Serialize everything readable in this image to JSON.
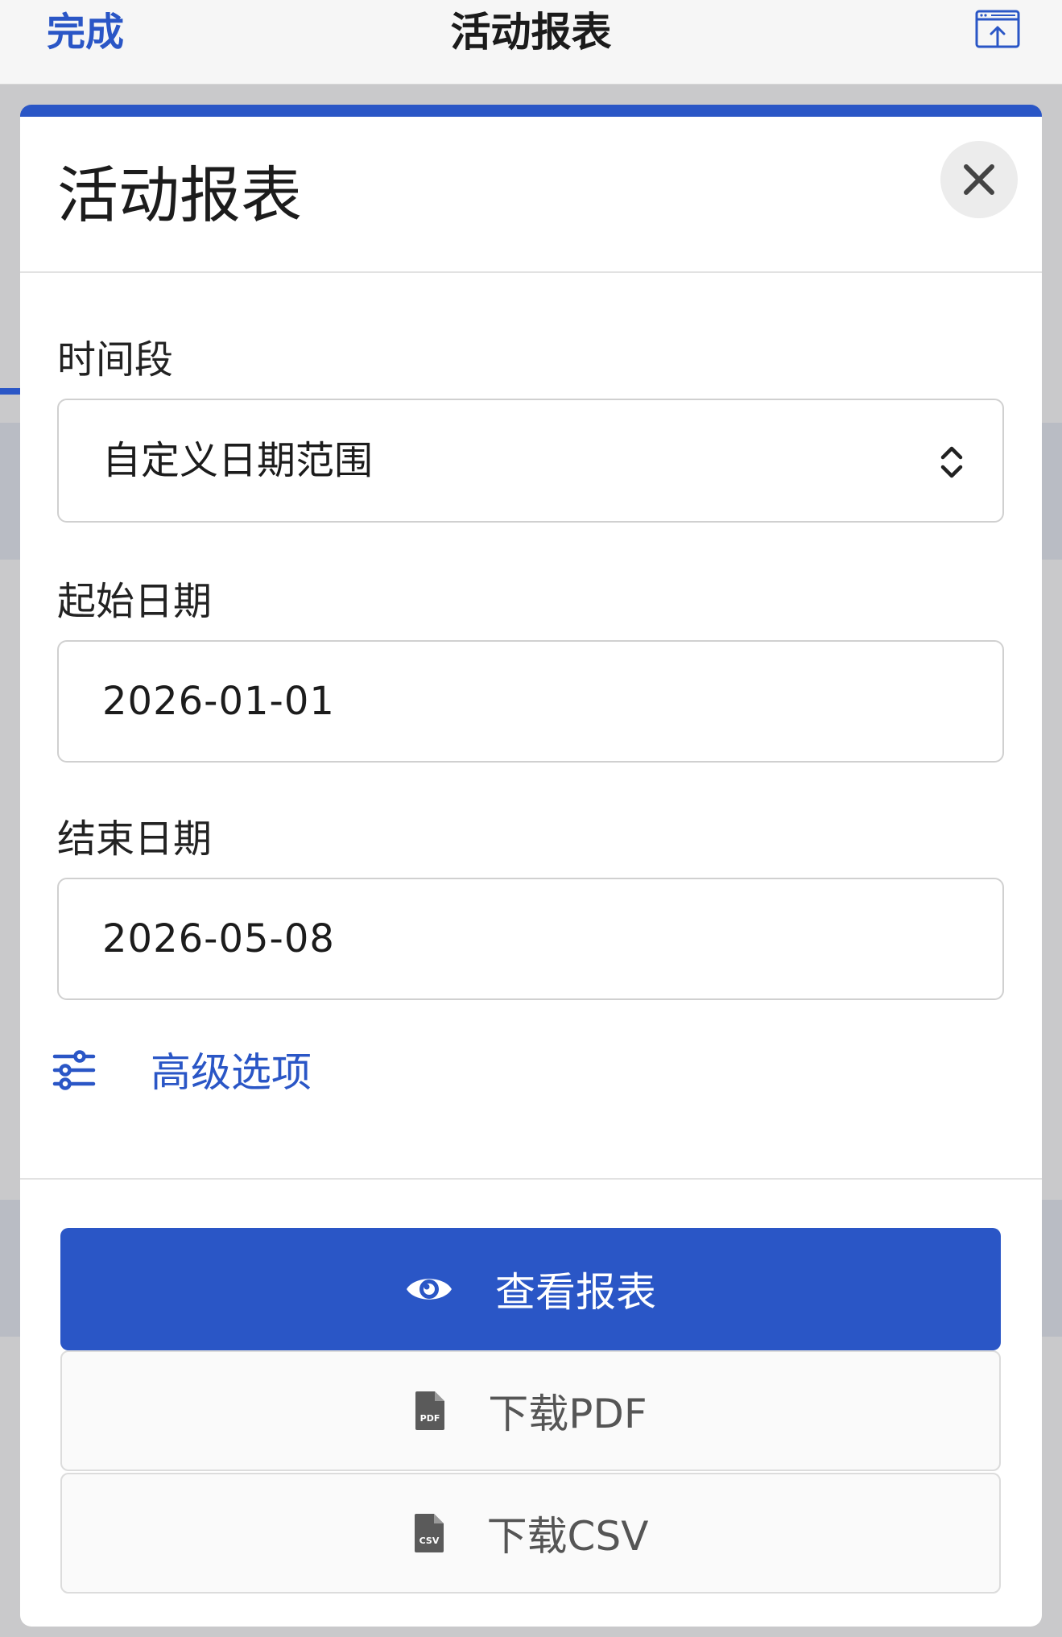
{
  "nav": {
    "done_label": "完成",
    "title": "活动报表",
    "share_icon": "share-window-icon"
  },
  "sheet": {
    "title": "活动报表",
    "close_icon": "close-icon"
  },
  "form": {
    "period": {
      "label": "时间段",
      "value": "自定义日期范围",
      "icon": "chevron-up-down-icon"
    },
    "start_date": {
      "label": "起始日期",
      "value": "2026-01-01"
    },
    "end_date": {
      "label": "结束日期",
      "value": "2026-05-08"
    },
    "advanced": {
      "label": "高级选项",
      "icon": "sliders-icon"
    }
  },
  "actions": {
    "view": {
      "label": "查看报表",
      "icon": "eye-icon"
    },
    "pdf": {
      "label": "下载PDF",
      "icon": "pdf-file-icon"
    },
    "csv": {
      "label": "下载CSV",
      "icon": "csv-file-icon"
    }
  },
  "colors": {
    "accent": "#2a56c6",
    "overlay": "#c9c9cb",
    "sheet": "#ffffff"
  }
}
